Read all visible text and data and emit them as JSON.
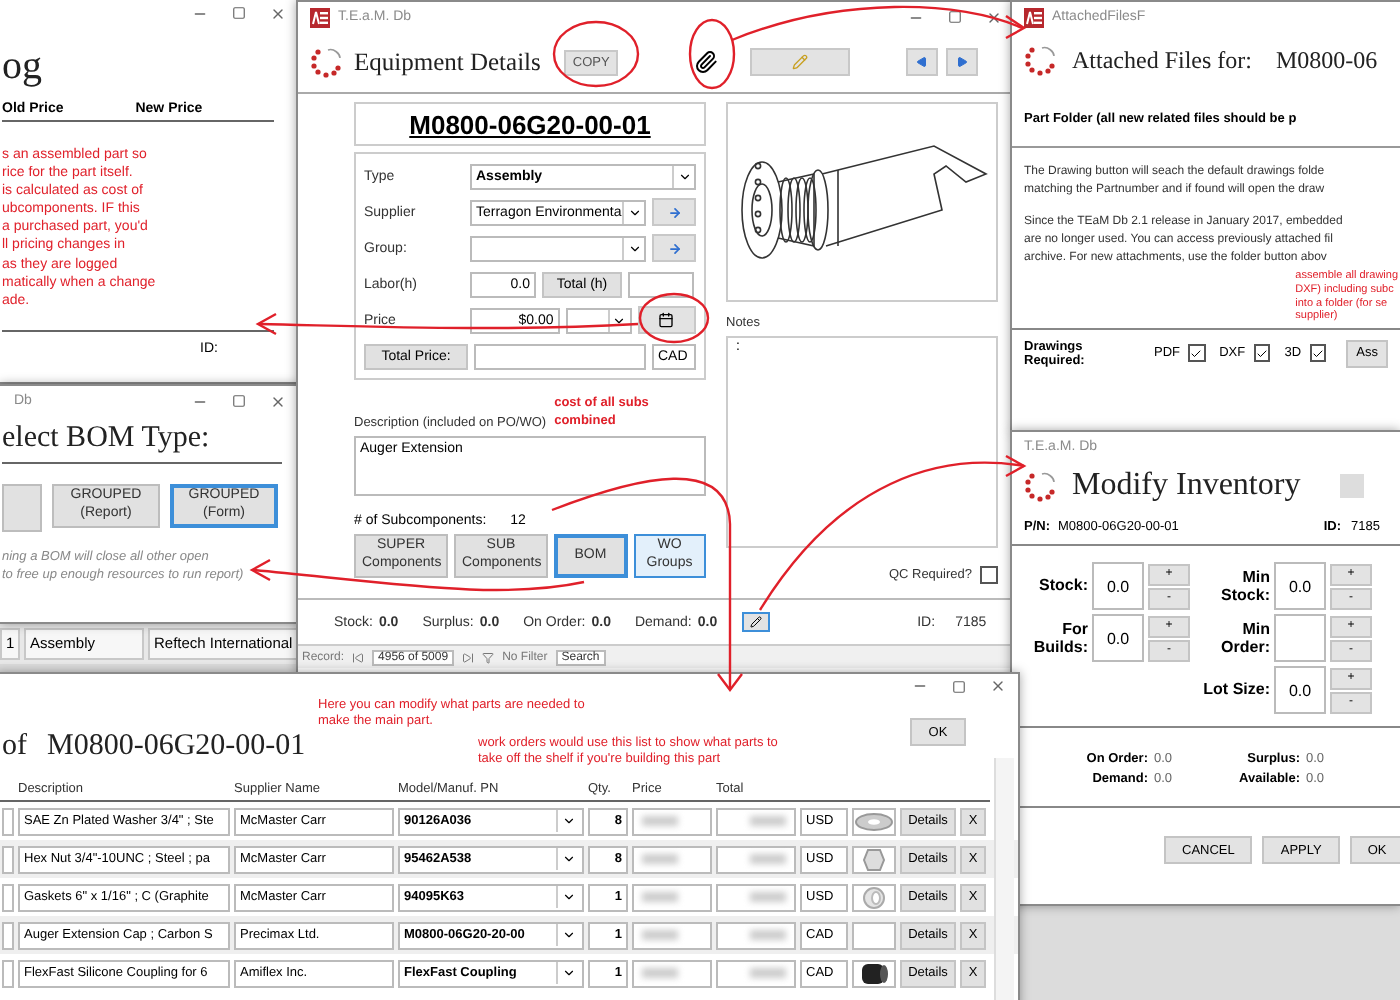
{
  "price_log": {
    "title": "og",
    "columns": [
      "Old Price",
      "New Price"
    ],
    "note_lines": [
      "s an assembled part so",
      "rice for the part itself.",
      "is calculated as cost of",
      "ubcomponents. IF this",
      "a purchased part, you'd",
      "ll pricing changes in",
      "as they are logged",
      "matically when a change",
      "ade."
    ],
    "id_label": "ID:"
  },
  "bom_type": {
    "app_title": "Db",
    "title": "elect BOM Type:",
    "buttons": [
      {
        "label": "GROUPED\n(Report)",
        "selected": false
      },
      {
        "label": "GROUPED\n(Form)",
        "selected": true
      }
    ],
    "note_lines": [
      "ning a BOM will close all other open",
      "to free up enough resources to run report)"
    ]
  },
  "background_row": [
    "1",
    "Assembly",
    "Reftech International"
  ],
  "equipment": {
    "app_title": "T.E.a.M. Db",
    "title": "Equipment Details",
    "copy_label": "COPY",
    "part_number": "M0800-06G20-00-01",
    "fields": {
      "type_label": "Type",
      "type": "Assembly",
      "supplier_label": "Supplier",
      "supplier": "Terragon Environmenta",
      "group_label": "Group:",
      "labor_label": "Labor(h)",
      "labor": "0.0",
      "total_hours_label": "Total (h)",
      "price_label": "Price",
      "price": "$0.00",
      "total_price_label": "Total Price:",
      "currency": "CAD"
    },
    "cost_note": "cost of all subs\ncombined",
    "description_label": "Description (included on PO/WO)",
    "description": "Auger Extension",
    "subcomponents_label": "# of Subcomponents:",
    "subcomponents": "12",
    "buttons": [
      {
        "label": "SUPER\nComponents",
        "selected": false,
        "kind": "plain"
      },
      {
        "label": "SUB\nComponents",
        "selected": false,
        "kind": "plain"
      },
      {
        "label": "BOM",
        "selected": true,
        "kind": "plain"
      },
      {
        "label": "WO\nGroups",
        "selected": false,
        "kind": "link"
      }
    ],
    "notes_label": "Notes",
    "notes": ":",
    "qc_label": "QC Required?",
    "qc_checked": false,
    "stats": [
      {
        "label": "Stock:",
        "value": "0.0"
      },
      {
        "label": "Surplus:",
        "value": "0.0"
      },
      {
        "label": "On Order:",
        "value": "0.0"
      },
      {
        "label": "Demand:",
        "value": "0.0"
      }
    ],
    "id_label": "ID:",
    "id": "7185",
    "record": {
      "label": "Record:",
      "position": "4956 of 5009",
      "filter": "No Filter",
      "placeholder": "Search"
    }
  },
  "attached_files": {
    "app_title": "AttachedFilesF",
    "title": "Attached Files for:",
    "part_number": "M0800-06",
    "folder_heading": "Part Folder (all new related files should be p",
    "paragraphs": [
      [
        "The Drawing button will seach the default drawings folde",
        "matching the Partnumber and if found will open the draw"
      ],
      [
        "Since the TEaM Db 2.1 release in January 2017, embedded",
        "are no longer used. You can access previously attached fil",
        "archive. For new attachments, use the folder button abov"
      ]
    ],
    "annotation": "assemble all drawing\nDXF) including subc\ninto a folder (for se\nsupplier)",
    "drawings_label": "Drawings Required:",
    "drawings": [
      {
        "label": "PDF",
        "checked": true
      },
      {
        "label": "DXF",
        "checked": true
      },
      {
        "label": "3D",
        "checked": true
      }
    ],
    "assemble_label": "Ass"
  },
  "modify_inventory": {
    "app_title": "T.E.a.M. Db",
    "title": "Modify Inventory",
    "pn_label": "P/N:",
    "pn": "M0800-06G20-00-01",
    "id_label": "ID:",
    "id": "7185",
    "left_fields": [
      {
        "label": "Stock:",
        "value": "0.0",
        "plus": "+",
        "minus": "-"
      },
      {
        "label": "For\nBuilds:",
        "value": "0.0",
        "plus": "+",
        "minus": "-"
      }
    ],
    "right_fields": [
      {
        "label": "Min\nStock:",
        "value": "0.0",
        "plus": "+",
        "minus": "-"
      },
      {
        "label": "Min\nOrder:",
        "plus": "+",
        "minus": "-"
      },
      {
        "label": "Lot Size:",
        "value": "0.0",
        "plus": "+",
        "minus": "-"
      }
    ],
    "summary": [
      {
        "label": "On Order:",
        "value": "0.0"
      },
      {
        "label": "Surplus:",
        "value": "0.0"
      },
      {
        "label": "Demand:",
        "value": "0.0"
      },
      {
        "label": "Available:",
        "value": "0.0"
      }
    ],
    "buttons": [
      "CANCEL",
      "APPLY",
      "OK"
    ]
  },
  "bom": {
    "title": "of",
    "part_number": "M0800-06G20-00-01",
    "annotations": [
      "Here you can modify what parts are needed to\nmake the main part.",
      "work orders would use this list to show what parts to\ntake off the shelf if you're building this part"
    ],
    "ok_label": "OK",
    "columns": [
      "Description",
      "Supplier Name",
      "Model/Manuf. PN",
      "Qty.",
      "Price",
      "Total"
    ],
    "rows": [
      {
        "description": "SAE Zn Plated Washer 3/4\" ; Ste",
        "supplier": "McMaster Carr",
        "pn": "90126A036",
        "qty": "8",
        "currency": "USD",
        "kind": "washer",
        "details": "Details",
        "remove": "X"
      },
      {
        "description": "Hex Nut 3/4\"-10UNC ; Steel ; pa",
        "supplier": "McMaster Carr",
        "pn": "95462A538",
        "qty": "8",
        "currency": "USD",
        "kind": "nut",
        "details": "Details",
        "remove": "X"
      },
      {
        "description": "Gaskets 6\" x 1/16\" ; C (Graphite",
        "supplier": "McMaster Carr",
        "pn": "94095K63",
        "qty": "1",
        "currency": "USD",
        "kind": "gasket",
        "details": "Details",
        "remove": "X"
      },
      {
        "description": "Auger Extension Cap ; Carbon S",
        "supplier": "Precimax Ltd.",
        "pn": "M0800-06G20-20-00",
        "qty": "1",
        "currency": "CAD",
        "kind": "none",
        "details": "Details",
        "remove": "X"
      },
      {
        "description": "FlexFast Silicone Coupling for 6",
        "supplier": "Amiflex Inc.",
        "pn": "FlexFast Coupling",
        "qty": "1",
        "currency": "CAD",
        "kind": "coupling",
        "details": "Details",
        "remove": "X"
      }
    ]
  }
}
